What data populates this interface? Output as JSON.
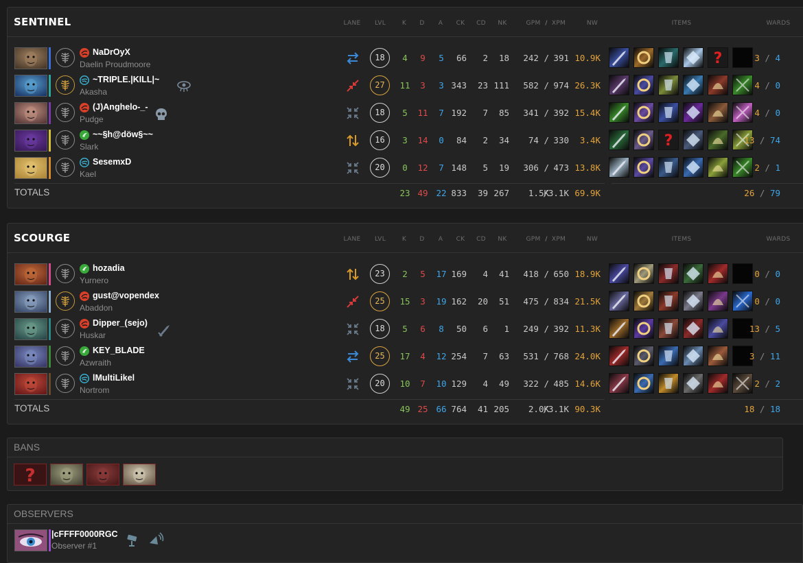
{
  "headers": {
    "lane": "LANE",
    "lvl": "LVL",
    "k": "K",
    "d": "D",
    "a": "A",
    "ck": "CK",
    "cd": "CD",
    "nk": "NK",
    "gpm": "GPM",
    "slash": "/",
    "xpm": "XPM",
    "nw": "NW",
    "items": "ITEMS",
    "wards": "WARDS"
  },
  "totals_label": "TOTALS",
  "teams": [
    {
      "name": "SENTINEL",
      "players": [
        {
          "player": "NaDrOyX",
          "hero": "Daelin Proudmoore",
          "lane": "swap",
          "lvl": "18",
          "k": "4",
          "d": "9",
          "a": "5",
          "ck": "66",
          "cd": "2",
          "nk": "18",
          "gpm": "242 /",
          "xpm": "391",
          "nw": "10.9K",
          "wards_obs": "3",
          "wards_sent": "4",
          "rank": "red",
          "bar": "#3b6fd8",
          "tree": "grey",
          "portrait": [
            "#4a3a2a",
            "#a08060"
          ],
          "items": [
            "#3a4fa0",
            "#9c6a2a",
            "#2a6a6a",
            "#a9c6e6",
            "unknown",
            "empty"
          ]
        },
        {
          "player": "~TRIPLE.|KILL|~",
          "hero": "Akasha",
          "lane": "mid",
          "lvl": "27",
          "k": "11",
          "d": "3",
          "a": "3",
          "ck": "343",
          "cd": "23",
          "nk": "111",
          "gpm": "582 /",
          "xpm": "974",
          "nw": "26.3K",
          "wards_obs": "4",
          "wards_sent": "0",
          "rank": "blue",
          "bar": "#2aa8a0",
          "tree": "gold",
          "portrait": [
            "#1c3a6a",
            "#5aa0d0"
          ],
          "items": [
            "#5a3a6a",
            "#4a4aa0",
            "#7a8a3a",
            "#3a7ab0",
            "#8a3a2a",
            "#3a8a2a"
          ],
          "extra": "eye-icon"
        },
        {
          "player": "(J)Anghelo-_-",
          "hero": "Pudge",
          "lane": "jungle",
          "lvl": "18",
          "k": "5",
          "d": "11",
          "a": "7",
          "ck": "192",
          "cd": "7",
          "nk": "85",
          "gpm": "341 /",
          "xpm": "392",
          "nw": "15.4K",
          "wards_obs": "4",
          "wards_sent": "0",
          "rank": "red",
          "bar": "#7a3aa8",
          "tree": "grey",
          "portrait": [
            "#5a3a3a",
            "#c09080"
          ],
          "items": [
            "#3a8a2a",
            "#6a4aa0",
            "#3a4fa0",
            "#6a2a9a",
            "#8a5a3a",
            "#c060c0"
          ],
          "extra": "skull-icon"
        },
        {
          "player": "~~§h@döw§~~",
          "hero": "Slark",
          "lane": "off",
          "lvl": "16",
          "k": "3",
          "d": "14",
          "a": "0",
          "ck": "84",
          "cd": "2",
          "nk": "34",
          "gpm": "74 /",
          "xpm": "330",
          "nw": "3.4K",
          "wards_obs": "13",
          "wards_sent": "74",
          "rank": "green",
          "bar": "#d9c03a",
          "tree": "grey",
          "portrait": [
            "#3a1a5a",
            "#6a3aa0"
          ],
          "items": [
            "#2a6a3a",
            "#6a5a8a",
            "unknown",
            "#4a5a7a",
            "#4a6a2a",
            "#8aa03a"
          ]
        },
        {
          "player": "SesemxD",
          "hero": "Kael",
          "lane": "jungle",
          "lvl": "20",
          "k": "0",
          "d": "12",
          "a": "7",
          "ck": "148",
          "cd": "5",
          "nk": "19",
          "gpm": "306 /",
          "xpm": "473",
          "nw": "13.8K",
          "wards_obs": "2",
          "wards_sent": "1",
          "rank": "blue",
          "bar": "#d98a2a",
          "tree": "grey",
          "portrait": [
            "#b08a3a",
            "#e0c070"
          ],
          "items": [
            "#9ab0c0",
            "#5a4aa0",
            "#3a5a8a",
            "#3a6ab0",
            "#8aa03a",
            "#3a8a2a"
          ]
        }
      ],
      "totals": {
        "k": "23",
        "d": "49",
        "a": "22",
        "ck": "833",
        "cd": "39",
        "nk": "267",
        "gpm": "1.5K",
        "xpm": "/3.1K",
        "nw": "69.9K",
        "wards_obs": "26",
        "wards_sent": "79"
      }
    },
    {
      "name": "SCOURGE",
      "players": [
        {
          "player": "hozadia",
          "hero": "Yurnero",
          "lane": "off",
          "lvl": "23",
          "k": "2",
          "d": "5",
          "a": "17",
          "ck": "169",
          "cd": "4",
          "nk": "41",
          "gpm": "418 /",
          "xpm": "650",
          "nw": "18.9K",
          "wards_obs": "0",
          "wards_sent": "0",
          "rank": "green",
          "bar": "#d94a8a",
          "tree": "grey",
          "portrait": [
            "#6a2a1a",
            "#c06a3a"
          ],
          "items": [
            "#4a4aa0",
            "#a09a7a",
            "#8a2a2a",
            "#3a6a3a",
            "#a02a2a",
            "empty"
          ]
        },
        {
          "player": "gust@vopendex",
          "hero": "Abaddon",
          "lane": "mid",
          "lvl": "25",
          "k": "15",
          "d": "3",
          "a": "19",
          "ck": "162",
          "cd": "20",
          "nk": "51",
          "gpm": "475 /",
          "xpm": "834",
          "nw": "21.5K",
          "wards_obs": "0",
          "wards_sent": "0",
          "rank": "red",
          "bar": "#8ab0d8",
          "tree": "gold",
          "portrait": [
            "#3a4a6a",
            "#8aa0c0"
          ],
          "items": [
            "#6a6aa0",
            "#a07a3a",
            "#8a3a2a",
            "#7a7a8a",
            "#7a3a8a",
            "#2a6ad0"
          ]
        },
        {
          "player": "Dipper_(sejo)",
          "hero": "Huskar",
          "lane": "jungle",
          "lvl": "18",
          "k": "5",
          "d": "6",
          "a": "8",
          "ck": "50",
          "cd": "6",
          "nk": "1",
          "gpm": "249 /",
          "xpm": "392",
          "nw": "11.3K",
          "wards_obs": "13",
          "wards_sent": "5",
          "rank": "red",
          "bar": "#2a8a8a",
          "tree": "grey",
          "portrait": [
            "#2a4a4a",
            "#6a9a8a"
          ],
          "items": [
            "#9c6a2a",
            "#5a3aa0",
            "#8a4a3a",
            "#8a2a2a",
            "#4a4aa0",
            "empty"
          ],
          "extra": "sword-icon"
        },
        {
          "player": "KEY_BLADE",
          "hero": "Azwraith",
          "lane": "swap",
          "lvl": "25",
          "k": "17",
          "d": "4",
          "a": "12",
          "ck": "254",
          "cd": "7",
          "nk": "63",
          "gpm": "531 /",
          "xpm": "768",
          "nw": "24.0K",
          "wards_obs": "3",
          "wards_sent": "11",
          "rank": "green",
          "bar": "#3a8a3a",
          "tree": "grey",
          "portrait": [
            "#3a3a6a",
            "#7a8ac0"
          ],
          "items": [
            "#a02a2a",
            "#5a5a6a",
            "#3a6ab0",
            "#6a8ab0",
            "#9a5a3a",
            "empty"
          ]
        },
        {
          "player": "lMultiLikel",
          "hero": "Nortrom",
          "lane": "jungle",
          "lvl": "20",
          "k": "10",
          "d": "7",
          "a": "10",
          "ck": "129",
          "cd": "4",
          "nk": "49",
          "gpm": "322 /",
          "xpm": "485",
          "nw": "14.6K",
          "wards_obs": "2",
          "wards_sent": "2",
          "rank": "blue",
          "bar": "#6a4a2a",
          "tree": "grey",
          "portrait": [
            "#6a1a1a",
            "#c04a3a"
          ],
          "items": [
            "#8a3a4a",
            "#3a6ab0",
            "#c08a2a",
            "#6a6a6a",
            "#a02a2a",
            "#5a4a3a"
          ]
        }
      ],
      "totals": {
        "k": "49",
        "d": "25",
        "a": "66",
        "ck": "764",
        "cd": "41",
        "nk": "205",
        "gpm": "2.0K",
        "xpm": "/3.1K",
        "nw": "90.3K",
        "wards_obs": "18",
        "wards_sent": "18"
      }
    }
  ],
  "bans": {
    "title": "BANS",
    "heroes": [
      {
        "icon": "unknown-icon",
        "colors": [
          "#5a1a1a",
          "#8a2a2a"
        ]
      },
      {
        "icon": "hero-portrait",
        "colors": [
          "#4a4a3a",
          "#a0a080"
        ]
      },
      {
        "icon": "hero-portrait",
        "colors": [
          "#4a1a1a",
          "#8a3a3a"
        ]
      },
      {
        "icon": "hero-portrait",
        "colors": [
          "#6a5a4a",
          "#d0c8b0"
        ]
      }
    ]
  },
  "observers": {
    "title": "OBSERVERS",
    "name": "|cFFFF0000RGC",
    "sub": "Observer #1",
    "icons": [
      "camera-icon",
      "broadcast-icon"
    ]
  },
  "colors": {
    "kill": "#87c45a",
    "death": "#df4a4a",
    "assist": "#3fa6ea",
    "networth": "#e3a33b",
    "panel": "#232323",
    "background": "#1b1b1b"
  }
}
